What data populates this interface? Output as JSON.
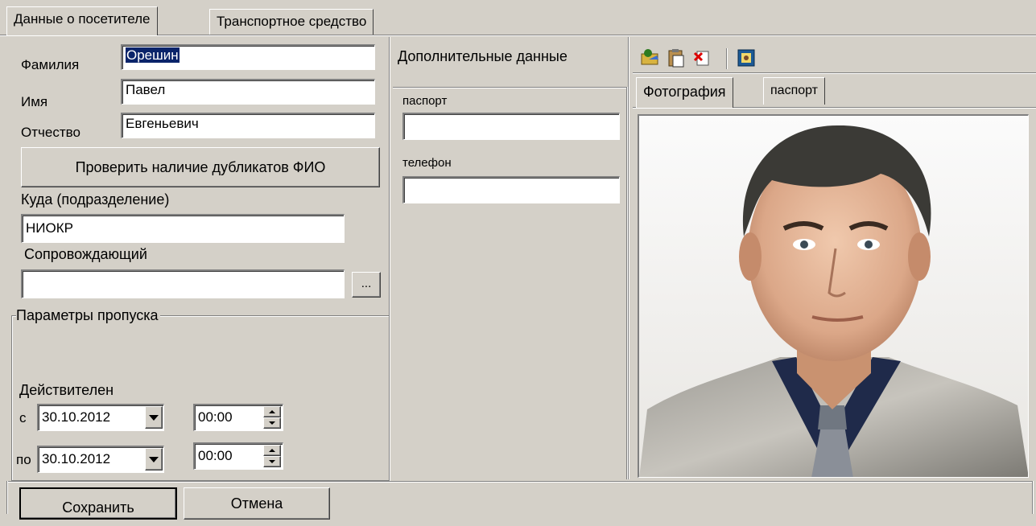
{
  "tabs": [
    {
      "label": "Данные о посетителе"
    },
    {
      "label": "Транспортное средство"
    }
  ],
  "visitor": {
    "surname_label": "Фамилия",
    "surname_value": "Орешин",
    "name_label": "Имя",
    "name_value": "Павел",
    "patronymic_label": "Отчество",
    "patronymic_value": "Евгеньевич",
    "check_duplicates_label": "Проверить наличие дубликатов ФИО",
    "department_label": "Куда (подразделение)",
    "department_value": "НИОКР",
    "escort_label": "Сопровождающий",
    "escort_value": "",
    "browse_label": "..."
  },
  "pass": {
    "group_label": "Параметры пропуска",
    "valid_label": "Действителен",
    "from_label": "с",
    "from_date": "30.10.2012",
    "from_time": "00:00",
    "to_label": "по",
    "to_date": "30.10.2012",
    "to_time": "00:00"
  },
  "additional": {
    "title": "Дополнительные данные",
    "passport_label": "паспорт",
    "passport_value": "",
    "phone_label": "телефон",
    "phone_value": ""
  },
  "photo_panel": {
    "toolbar_icons": [
      "open-photo-icon",
      "paste-icon",
      "delete-photo-icon",
      "capture-photo-icon"
    ],
    "tabs": [
      {
        "label": "Фотография"
      },
      {
        "label": "паспорт"
      }
    ]
  },
  "footer": {
    "save_label": "Сохранить",
    "cancel_label": "Отмена"
  },
  "colors": {
    "window_bg": "#d4d0c8",
    "selection": "#0a246a"
  }
}
